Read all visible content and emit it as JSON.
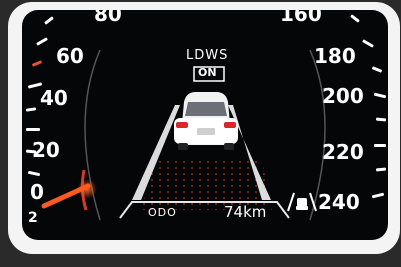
{
  "speedometer": {
    "left_scale": [
      "80",
      "60",
      "40",
      "20",
      "0"
    ],
    "right_scale": [
      "160",
      "180",
      "200",
      "220",
      "240"
    ]
  },
  "ldws": {
    "title": "LDWS",
    "status": "ON"
  },
  "info_bar": {
    "odo_label": "ODO",
    "distance": "74km"
  },
  "corner_badge": "2",
  "colors": {
    "background": "#050608",
    "needle": "#ff5a1f",
    "red_tick": "#e0532f",
    "text": "#ffffff"
  },
  "icons": [
    "lane-assist-icon",
    "car-rear-icon"
  ]
}
